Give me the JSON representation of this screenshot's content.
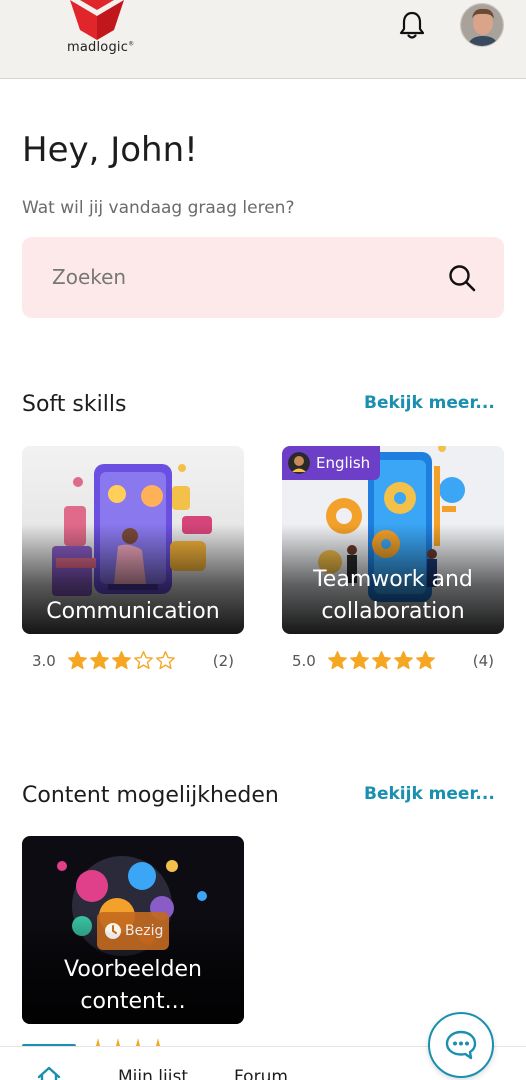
{
  "header": {
    "logo_text": "madlogic",
    "logo_mark": "®",
    "notification_icon": "bell-icon",
    "avatar_icon": "user-avatar"
  },
  "greeting": "Hey, John!",
  "subtitle": "Wat wil jij vandaag graag leren?",
  "search": {
    "placeholder": "Zoeken",
    "value": ""
  },
  "sections": [
    {
      "title": "Soft skills",
      "more_label": "Bekijk meer...",
      "cards": [
        {
          "title": "Communication",
          "rating": "3.0",
          "stars": 3,
          "count": "(2)",
          "badge": ""
        },
        {
          "title": "Teamwork and collaboration",
          "rating": "5.0",
          "stars": 5,
          "count": "(4)",
          "badge": "English"
        }
      ]
    },
    {
      "title": "Content mogelijkheden",
      "more_label": "Bekijk meer...",
      "cards": [
        {
          "title": "Voorbeelden content...",
          "status": "Bezig"
        }
      ]
    }
  ],
  "bottom_nav": {
    "items": [
      "Mijn lijst",
      "Forum"
    ]
  },
  "colors": {
    "accent": "#1a8fb0",
    "star": "#f5a623",
    "search_bg": "#fde9e9",
    "language_badge": "#6d3fc9",
    "status_badge": "#c46a1f"
  }
}
